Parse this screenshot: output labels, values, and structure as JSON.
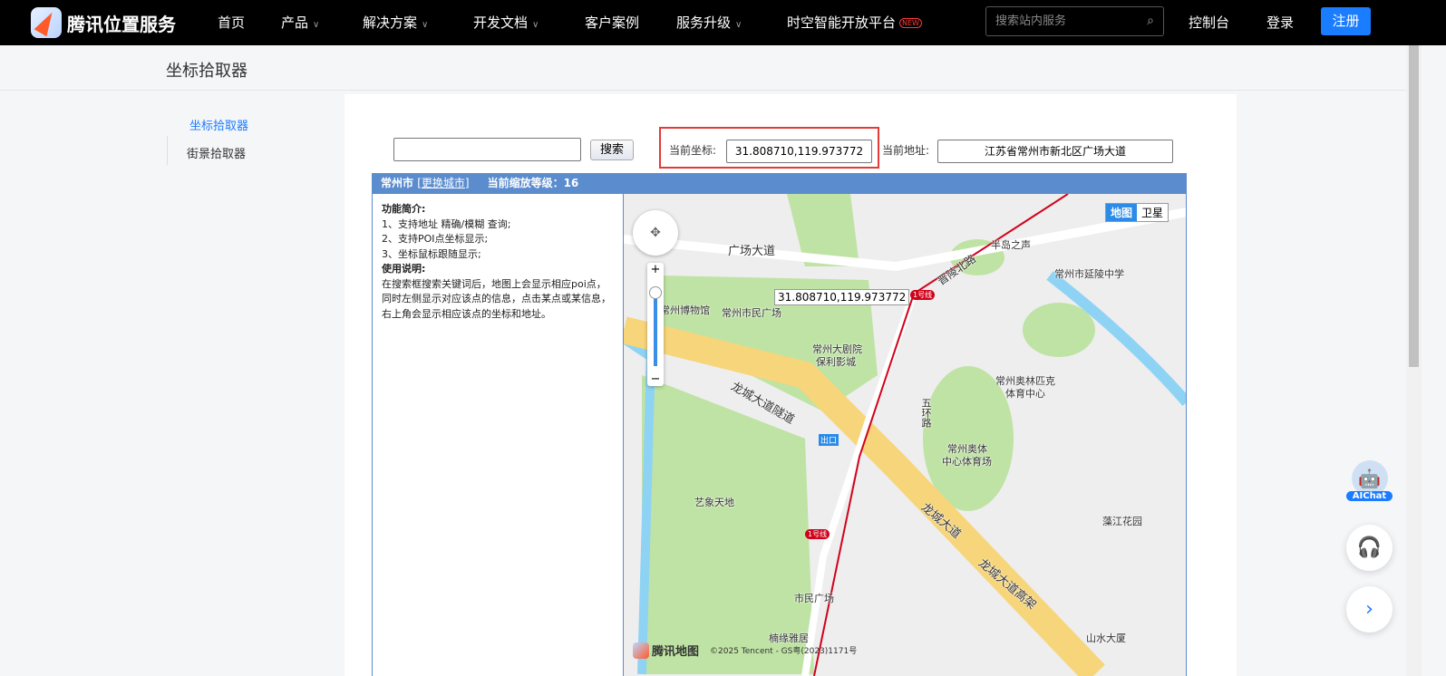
{
  "nav": {
    "logo": "腾讯位置服务",
    "items": [
      "首页",
      "产品",
      "解决方案",
      "开发文档",
      "客户案例",
      "服务升级",
      "时空智能开放平台"
    ],
    "new_badge": "NEW",
    "search_placeholder": "搜索站内服务",
    "console": "控制台",
    "login": "登录",
    "register": "注册"
  },
  "page_title": "坐标拾取器",
  "sidebar": {
    "items": [
      "坐标拾取器",
      "街景拾取器"
    ]
  },
  "picker": {
    "search_value": "",
    "search_button": "搜索",
    "coord_label": "当前坐标:",
    "coord_value": "31.808710,119.973772",
    "address_label": "当前地址:",
    "address_value": "江苏省常州市新北区广场大道"
  },
  "bar": {
    "city": "常州市",
    "change_city": "[更换城市]",
    "zoom_level": "当前缩放等级：16"
  },
  "help": {
    "title1": "功能简介:",
    "lines1": [
      "1、支持地址 精确/模糊 查询;",
      "2、支持POI点坐标显示;",
      "3、坐标鼠标跟随显示;"
    ],
    "title2": "使用说明:",
    "desc": "在搜索框搜索关键词后，地图上会显示相应poi点，同时左侧显示对应该点的信息，点击某点或某信息，右上角会显示相应该点的坐标和地址。"
  },
  "map": {
    "type_map": "地图",
    "type_satellite": "卫星",
    "tooltip": "31.808710,119.973772",
    "labels": [
      "广场大道",
      "半岛之声",
      "常州市延陵中学",
      "常州博物馆",
      "常州市民广场",
      "常州大剧院",
      "保利影城",
      "龙城大道隧道",
      "常州奥林匹克",
      "体育中心",
      "五环路",
      "常州奥体",
      "中心体育场",
      "出口",
      "艺象天地",
      "龙城大道",
      "龙城大道高架",
      "藻江花园",
      "市民广场",
      "楠缘雅居",
      "山水大厦",
      "晋陵北路",
      "1号线",
      "1号线"
    ],
    "brand": "腾讯地图",
    "copyright": "©2025 Tencent - GS粤(2023)1171号"
  },
  "float": {
    "aichat": "AIChat"
  },
  "colors": {
    "accent": "#1a7cff",
    "bar": "#5b8cce",
    "highlight": "#e53935"
  }
}
